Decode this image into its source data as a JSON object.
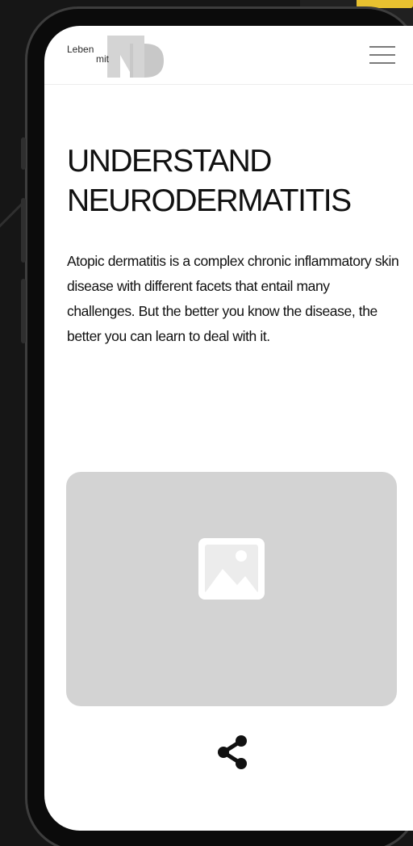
{
  "header": {
    "logo": {
      "line1": "Leben",
      "line2": "mit",
      "mark": "ND"
    },
    "menu_icon": "hamburger-menu-icon"
  },
  "main": {
    "title_line1": "UNDERSTAND",
    "title_line2": "NEURODERMATITIS",
    "intro": "Atopic dermatitis is a complex chronic inflammatory skin disease with different facets that entail many challenges. But the better you know the disease, the better you can learn to deal with it.",
    "media_icon": "image-placeholder-icon",
    "share_icon": "share-icon"
  },
  "colors": {
    "background": "#161616",
    "screen": "#ffffff",
    "text": "#111111",
    "placeholder": "#d3d3d3",
    "logo_mark": "#d4d4d4"
  }
}
